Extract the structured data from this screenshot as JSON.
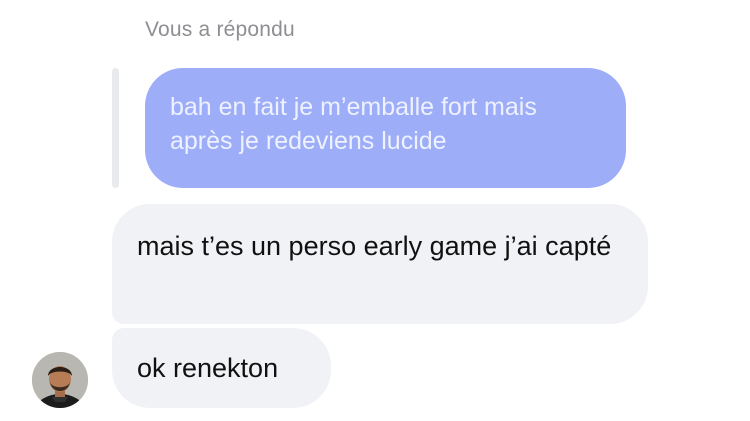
{
  "reply": {
    "header": "Vous a répondu",
    "quoted_message": "bah en fait je m’emballe fort mais après je redeviens lucide"
  },
  "messages": [
    {
      "text": "mais t’es un perso early game j’ai capté"
    },
    {
      "text": "ok renekton"
    }
  ],
  "avatar": {
    "icon": "profile-photo",
    "colors": {
      "background": "#b9b7b2",
      "hair": "#2b1f18",
      "skin": "#b67c55",
      "clothing": "#1c1c1c"
    }
  },
  "colors": {
    "quoted_bubble": "#9dadf8",
    "quoted_text": "#eef1ff",
    "incoming_bubble": "#f1f2f5",
    "incoming_text": "#111111",
    "header_text": "#8e8e93",
    "quote_bar": "#e9eaee"
  }
}
